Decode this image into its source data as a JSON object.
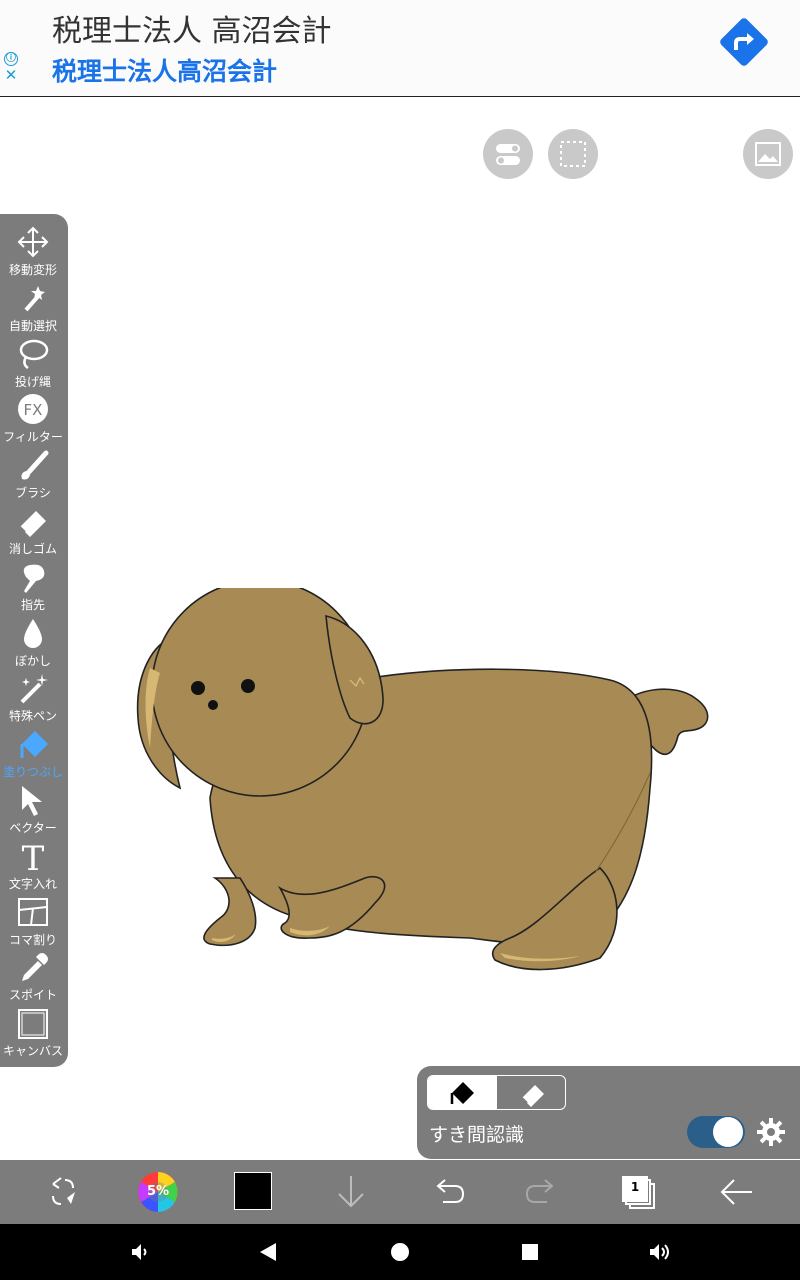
{
  "ad": {
    "title": "税理士法人 高沼会計",
    "subtitle": "税理士法人高沼会計",
    "info_icon": "ⓘ",
    "close_icon": "✕",
    "accent_color": "#1a73e8"
  },
  "toolbar": {
    "tools": [
      {
        "id": "move",
        "label": "移動変形",
        "icon": "move-arrows-icon"
      },
      {
        "id": "auto-select",
        "label": "自動選択",
        "icon": "magic-wand-icon"
      },
      {
        "id": "lasso",
        "label": "投げ縄",
        "icon": "lasso-icon"
      },
      {
        "id": "filter",
        "label": "フィルター",
        "icon": "fx-icon",
        "icon_text": "FX"
      },
      {
        "id": "brush",
        "label": "ブラシ",
        "icon": "brush-icon"
      },
      {
        "id": "eraser",
        "label": "消しゴム",
        "icon": "eraser-icon"
      },
      {
        "id": "finger",
        "label": "指先",
        "icon": "finger-icon"
      },
      {
        "id": "blur",
        "label": "ぼかし",
        "icon": "drop-icon"
      },
      {
        "id": "special-pen",
        "label": "特殊ペン",
        "icon": "sparkle-pen-icon"
      },
      {
        "id": "fill",
        "label": "塗りつぶし",
        "icon": "fill-bucket-icon",
        "active": true
      },
      {
        "id": "vector",
        "label": "ベクター",
        "icon": "cursor-arrow-icon"
      },
      {
        "id": "text",
        "label": "文字入れ",
        "icon": "text-t-icon",
        "icon_text": "T"
      },
      {
        "id": "panel",
        "label": "コマ割り",
        "icon": "panel-divide-icon"
      },
      {
        "id": "eyedropper",
        "label": "スポイト",
        "icon": "eyedropper-icon"
      },
      {
        "id": "canvas",
        "label": "キャンバス",
        "icon": "canvas-icon"
      }
    ],
    "active_color": "#4aa8ff"
  },
  "fill_panel": {
    "gap_label": "すき間認識",
    "gap_enabled": true,
    "mode": "fill"
  },
  "bottom": {
    "color_wheel_label": "5%",
    "current_color": "#000000",
    "page_count": "1"
  }
}
